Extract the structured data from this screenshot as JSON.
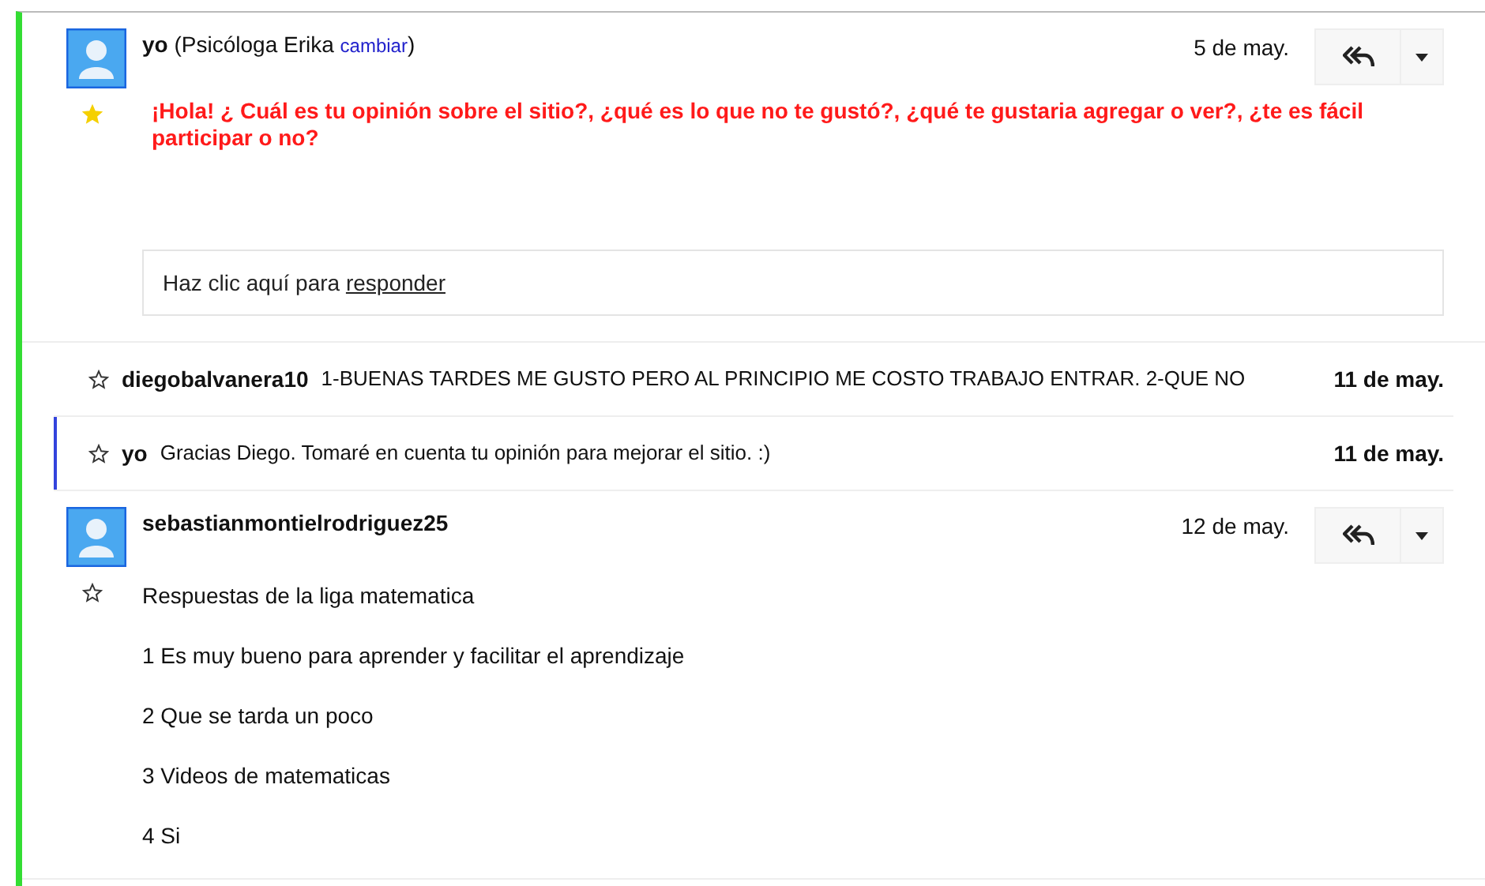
{
  "messages": [
    {
      "kind": "request",
      "starred": true,
      "sender": "yo",
      "identity": "(Psicóloga Erika",
      "change_link": "cambiar",
      "identity_close": ")",
      "date": "5 de may.",
      "body": [
        "¡Hola! ¿ Cuál es tu opinión sobre el sitio?, ¿qué es lo que no te gustó?, ¿qué te gustaria agregar o ver?, ¿te es fácil participar o no?"
      ],
      "reply_prompt": "Haz clic aquí para",
      "reply_link": "responder"
    },
    {
      "kind": "collapsed",
      "focused": false,
      "starred": false,
      "sender": "diegobalvanera10",
      "snippet": "1-BUENAS TARDES ME GUSTO PERO AL PRINCIPIO ME COSTO TRABAJO ENTRAR. 2-QUE NO",
      "date": "11 de may."
    },
    {
      "kind": "collapsed",
      "focused": true,
      "starred": false,
      "sender": "yo",
      "snippet": "Gracias Diego. Tomaré en cuenta tu opinión para mejorar el sitio. :)",
      "date": "11 de may."
    },
    {
      "kind": "expanded",
      "starred": false,
      "sender": "sebastianmontielrodriguez25",
      "date": "12 de may.",
      "body": [
        "Respuestas de la liga matematica",
        "1 Es muy bueno para aprender y facilitar el aprendizaje",
        "2 Que se tarda un poco",
        "3 Videos de matematicas",
        "4 Si"
      ]
    }
  ]
}
